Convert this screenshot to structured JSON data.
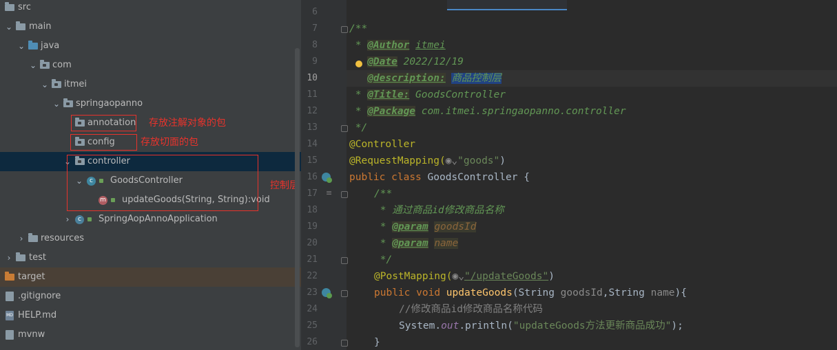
{
  "tree": {
    "src": "src",
    "main": "main",
    "java": "java",
    "com": "com",
    "itmei": "itmei",
    "springaopanno": "springaopanno",
    "annotation": "annotation",
    "config": "config",
    "controller": "controller",
    "goods_controller": "GoodsController",
    "update_goods": "updateGoods(String, String):void",
    "app": "SpringAopAnnoApplication",
    "resources": "resources",
    "test": "test",
    "target": "target",
    "gitignore": ".gitignore",
    "help": "HELP.md",
    "mvnw": "mvnw"
  },
  "annotations": {
    "annotation_note": "存放注解对象的包",
    "config_note": "存放切面的包",
    "controller_note": "控制层"
  },
  "editor": {
    "line_numbers": [
      "6",
      "7",
      "8",
      "9",
      "10",
      "11",
      "12",
      "13",
      "14",
      "15",
      "16",
      "17",
      "18",
      "19",
      "20",
      "21",
      "22",
      "23",
      "24",
      "25",
      "26"
    ],
    "current_line": "10",
    "doc_open": "/**",
    "star": " * ",
    "author_tag": "@Author",
    "author_val": "itmei",
    "date_tag": "@Date",
    "date_val": "2022/12/19",
    "desc_tag": "@description:",
    "desc_val": "商品控制层",
    "title_tag": "@Title:",
    "title_val": "GoodsController",
    "package_tag": "@Package",
    "package_val": "com.itmei.springaopanno.controller",
    "doc_close": " */",
    "ann_controller": "@Controller",
    "ann_reqmap": "@RequestMapping(",
    "reqmap_val": "\"goods\"",
    "close_paren": ")",
    "kw_public": "public",
    "kw_class": "class",
    "class_name": "GoodsController {",
    "inner_doc_open": "/**",
    "inner_doc_text": " * 通过商品id修改商品名称",
    "param_tag": "@param",
    "param1": "goodsId",
    "param2": "name",
    "inner_doc_close": " */",
    "ann_postmap": "@PostMapping(",
    "postmap_val": "\"/updateGoods\"",
    "kw_void": "void",
    "method_name": "updateGoods",
    "method_params_a": "(String ",
    "method_p1": "goodsId",
    "method_params_b": ",String ",
    "method_p2": "name",
    "method_params_c": "){",
    "comment_line": "//修改商品id修改商品名称代码",
    "println_a": "System.",
    "println_out": "out",
    "println_b": ".println(",
    "println_str": "\"updateGoods方法更新商品成功\"",
    "println_c": ");",
    "brace_close": "}"
  },
  "colors": {
    "tree_bg": "#3c3f41",
    "editor_bg": "#2b2b2b",
    "selection": "#0d293e",
    "annotation_red": "#e8332c"
  }
}
